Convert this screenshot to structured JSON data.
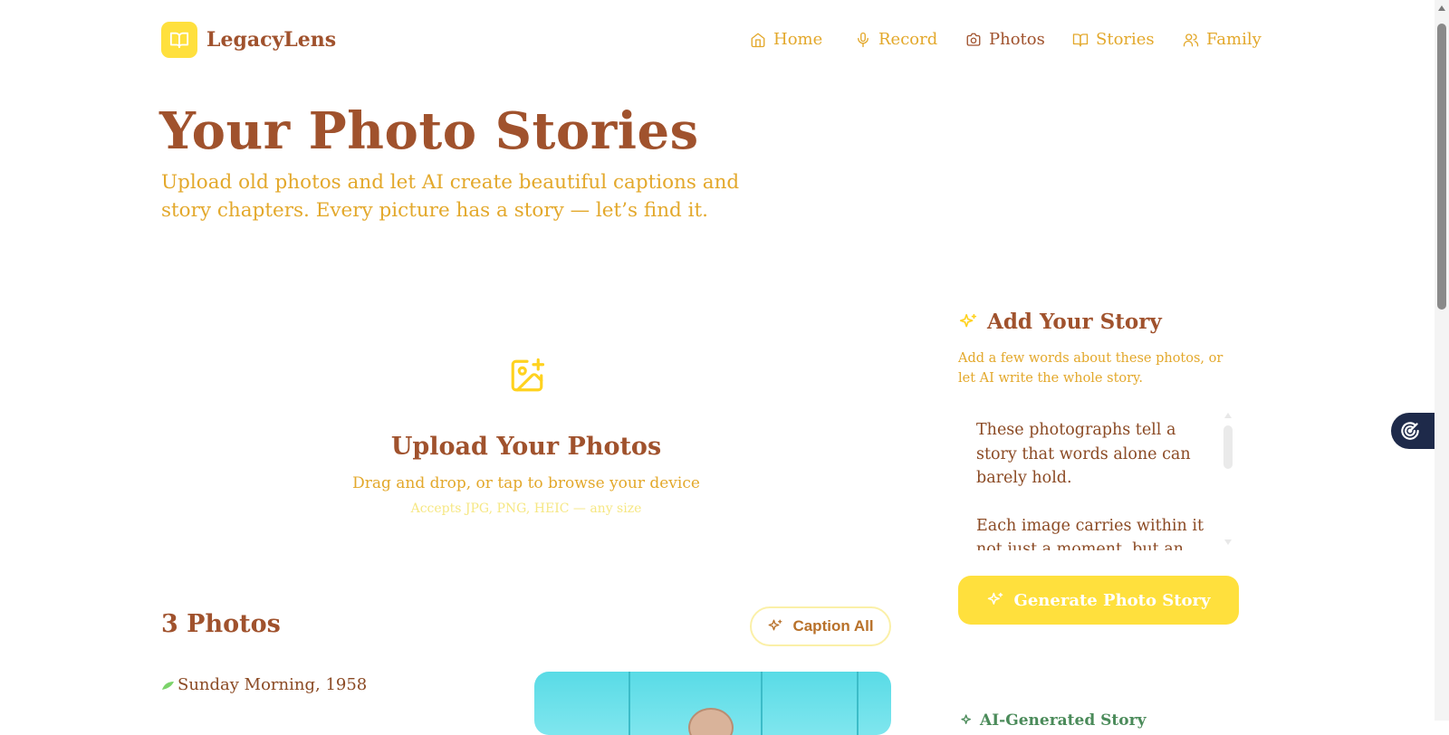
{
  "brand": {
    "name": "LegacyLens",
    "logo_icon": "book-open-icon",
    "accent": "#ffe03d"
  },
  "nav": [
    {
      "label": "Home",
      "icon": "home-icon"
    },
    {
      "label": "Record",
      "icon": "microphone-icon"
    },
    {
      "label": "Photos",
      "icon": "camera-icon"
    },
    {
      "label": "Stories",
      "icon": "book-open-icon"
    },
    {
      "label": "Family",
      "icon": "users-icon"
    }
  ],
  "hero": {
    "title": "Your Photo Stories",
    "subtitle": "Upload old photos and let AI create beautiful captions and story chapters. Every picture has a story — let’s find it."
  },
  "upload": {
    "title": "Upload Your Photos",
    "hint": "Drag and drop, or tap to browse your device",
    "accepted": "Accepts JPG, PNG, HEIC — any size",
    "icon": "image-plus-icon"
  },
  "photos": {
    "count_label": "3 Photos",
    "caption_all_label": "Caption All",
    "items": [
      {
        "caption": "Sunday Morning, 1958"
      }
    ]
  },
  "story_panel": {
    "title": "Add Your Story",
    "description": "Add a few words about these photos, or let AI write the whole story.",
    "paragraphs": [
      "These photographs tell a story that words alone can barely hold.",
      "Each image carries within it not just a moment, but an entire"
    ],
    "generate_label": "Generate Photo Story",
    "ai_section_label": "AI-Generated Story"
  },
  "colors": {
    "brown": "#a0522d",
    "gold": "#e3a82b",
    "yellow": "#ffe03d",
    "widget": "#1e2a4a"
  }
}
